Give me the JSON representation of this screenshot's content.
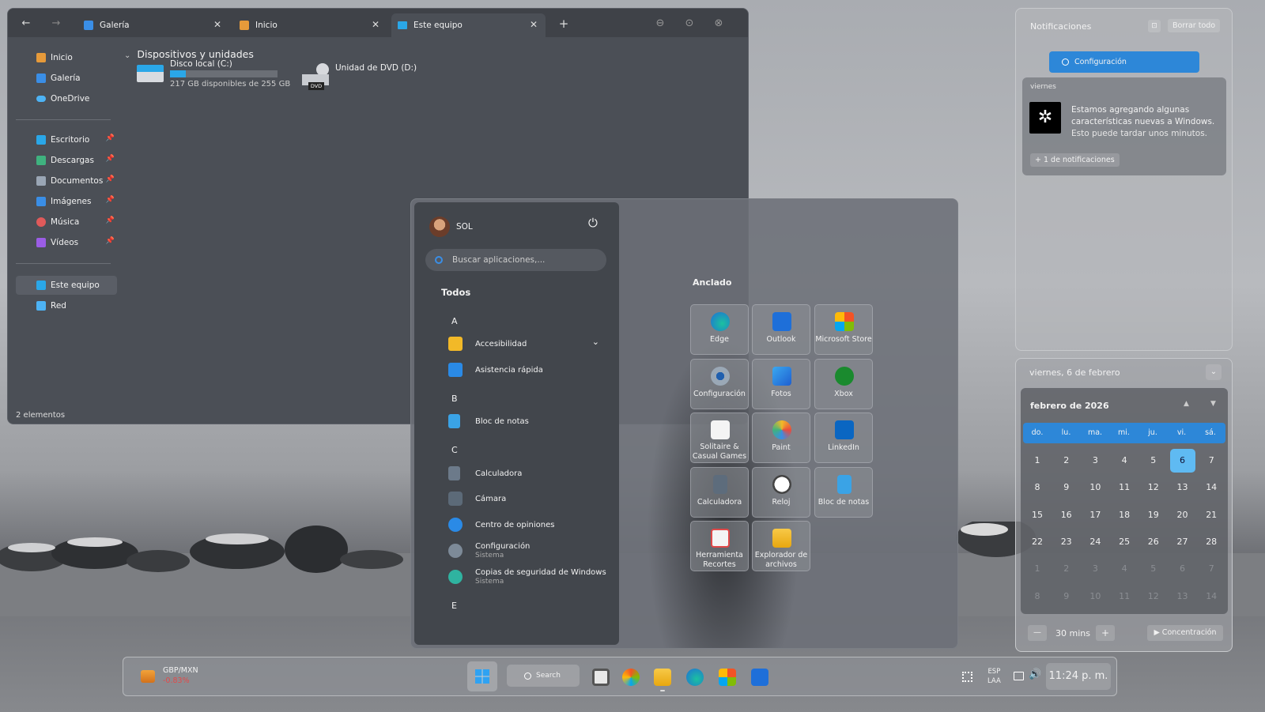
{
  "explorer": {
    "nav": {
      "back": "←",
      "forward": "→"
    },
    "tabs": [
      {
        "label": "Galería",
        "close": "✕"
      },
      {
        "label": "Inicio",
        "close": "✕"
      },
      {
        "label": "Este equipo",
        "close": "✕"
      }
    ],
    "new_tab": "+",
    "window_controls": {
      "minimize": "⊖",
      "maximize": "⊙",
      "close": "⊗"
    },
    "sidebar": {
      "top": [
        {
          "label": "Inicio",
          "icon": "home-icon"
        },
        {
          "label": "Galería",
          "icon": "gallery-icon"
        },
        {
          "label": "OneDrive",
          "icon": "onedrive-icon"
        }
      ],
      "quick": [
        {
          "label": "Escritorio",
          "icon": "desktop-icon"
        },
        {
          "label": "Descargas",
          "icon": "downloads-icon"
        },
        {
          "label": "Documentos",
          "icon": "documents-icon"
        },
        {
          "label": "Imágenes",
          "icon": "pictures-icon"
        },
        {
          "label": "Música",
          "icon": "music-icon"
        },
        {
          "label": "Vídeos",
          "icon": "videos-icon"
        }
      ],
      "bottom": [
        {
          "label": "Este equipo",
          "icon": "pc-icon"
        },
        {
          "label": "Red",
          "icon": "network-icon"
        }
      ]
    },
    "section_title": "Dispositivos y unidades",
    "drives": [
      {
        "name": "Disco local (C:)",
        "free": "217 GB disponibles de 255 GB",
        "used_fraction": 0.15
      },
      {
        "name": "Unidad de DVD (D:)",
        "badge": "DVD"
      }
    ],
    "status": "2 elementos"
  },
  "start": {
    "user": "SOL",
    "power_icon": "⏻",
    "search_placeholder": "Buscar aplicaciones,...",
    "all_title": "Todos",
    "letters": [
      "A",
      "B",
      "C",
      "E"
    ],
    "apps": [
      {
        "label": "Accesibilidad",
        "sub": "",
        "expand": "⌄"
      },
      {
        "label": "Asistencia rápida",
        "sub": ""
      },
      {
        "label": "Bloc de notas",
        "sub": ""
      },
      {
        "label": "Calculadora",
        "sub": ""
      },
      {
        "label": "Cámara",
        "sub": ""
      },
      {
        "label": "Centro de opiniones",
        "sub": ""
      },
      {
        "label": "Configuración",
        "sub": "Sistema"
      },
      {
        "label": "Copias de seguridad de Windows",
        "sub": "Sistema"
      }
    ],
    "pinned_title": "Anclado",
    "pinned": [
      {
        "label": "Edge"
      },
      {
        "label": "Outlook"
      },
      {
        "label": "Microsoft Store"
      },
      {
        "label": "Configuración"
      },
      {
        "label": "Fotos"
      },
      {
        "label": "Xbox"
      },
      {
        "label": "Solitaire & Casual Games"
      },
      {
        "label": "Paint"
      },
      {
        "label": "LinkedIn"
      },
      {
        "label": "Calculadora"
      },
      {
        "label": "Reloj"
      },
      {
        "label": "Bloc de notas"
      },
      {
        "label": "Herramienta Recortes"
      },
      {
        "label": "Explorador de archivos"
      }
    ]
  },
  "notifications": {
    "title": "Notificaciones",
    "clear_all": "Borrar todo",
    "settings_button": "Configuración",
    "day": "viernes",
    "message_line1": "Estamos agregando algunas",
    "message_line2": "características nuevas a Windows.",
    "message_line3": "Esto puede tardar unos minutos.",
    "more": "+ 1 de notificaciones"
  },
  "calendar": {
    "date_header": "viernes, 6 de febrero",
    "month": "febrero de 2026",
    "weekdays": [
      "do.",
      "lu.",
      "ma.",
      "mi.",
      "ju.",
      "vi.",
      "sá."
    ],
    "days": [
      "1",
      "2",
      "3",
      "4",
      "5",
      "6",
      "7",
      "8",
      "9",
      "10",
      "11",
      "12",
      "13",
      "14",
      "15",
      "16",
      "17",
      "18",
      "19",
      "20",
      "21",
      "22",
      "23",
      "24",
      "25",
      "26",
      "27",
      "28",
      "1",
      "2",
      "3",
      "4",
      "5",
      "6",
      "7",
      "8",
      "9",
      "10",
      "11",
      "12",
      "13",
      "14"
    ],
    "today": "6",
    "focus_minutes": "30 mins",
    "focus_minus": "—",
    "focus_plus": "+",
    "focus_button": "▶ Concentración"
  },
  "taskbar": {
    "widget_title": "GBP/MXN",
    "widget_value": "-0.83%",
    "search": "Search",
    "lang_top": "ESP",
    "lang_bottom": "LAA",
    "clock": "11:24 p. m."
  }
}
